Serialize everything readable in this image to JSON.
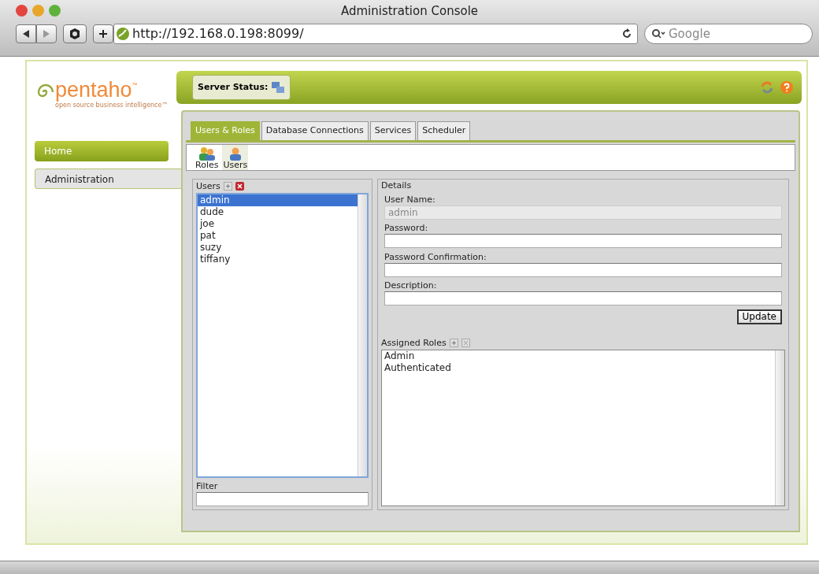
{
  "window": {
    "title": "Administration Console"
  },
  "browser": {
    "url": "http://192.168.0.198:8099/",
    "search_placeholder": "Google"
  },
  "logo": {
    "name": "pentaho",
    "trademark": "™",
    "tagline": "open source business intelligence™"
  },
  "nav": [
    {
      "label": "Home",
      "selected": false
    },
    {
      "label": "Administration",
      "selected": true
    }
  ],
  "header": {
    "label": "Server Status:"
  },
  "tabs": [
    {
      "label": "Users & Roles",
      "selected": true
    },
    {
      "label": "Database Connections",
      "selected": false
    },
    {
      "label": "Services",
      "selected": false
    },
    {
      "label": "Scheduler",
      "selected": false
    }
  ],
  "toolbar": [
    {
      "label": "Roles",
      "kind": "roles",
      "selected": false
    },
    {
      "label": "Users",
      "kind": "users",
      "selected": true
    }
  ],
  "users": {
    "title": "Users",
    "items": [
      {
        "label": "admin",
        "selected": true
      },
      {
        "label": "dude",
        "selected": false
      },
      {
        "label": "joe",
        "selected": false
      },
      {
        "label": "pat",
        "selected": false
      },
      {
        "label": "suzy",
        "selected": false
      },
      {
        "label": "tiffany",
        "selected": false
      }
    ],
    "filter_label": "Filter"
  },
  "details": {
    "title": "Details",
    "fields": [
      {
        "label": "User Name:",
        "value": "admin",
        "disabled": true
      },
      {
        "label": "Password:",
        "disabled": false
      },
      {
        "label": "Password Confirmation:",
        "disabled": false
      },
      {
        "label": "Description:",
        "disabled": false
      }
    ],
    "button": "Update",
    "roles_title": "Assigned Roles",
    "roles": [
      "Admin",
      "Authenticated"
    ]
  }
}
